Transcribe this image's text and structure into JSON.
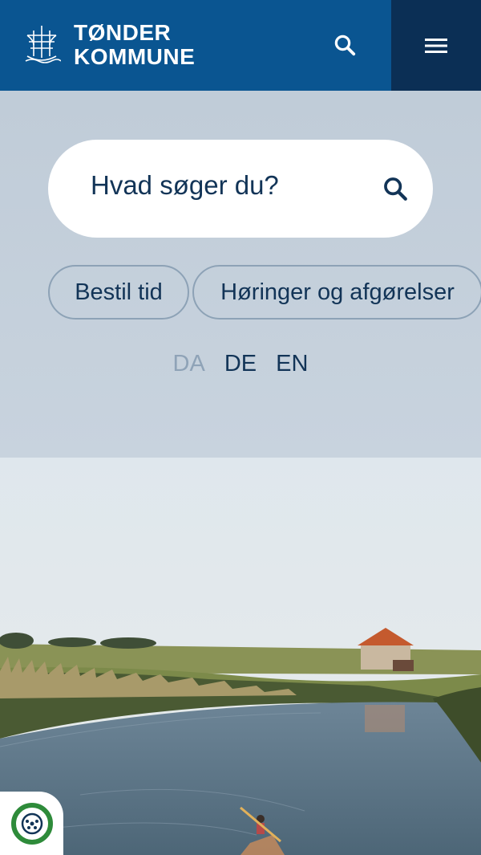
{
  "header": {
    "logo_line1": "TØNDER",
    "logo_line2": "KOMMUNE",
    "search_icon": "search-icon",
    "menu_icon": "hamburger-menu-icon",
    "background": "#0a5591",
    "menu_background": "#0b2f55"
  },
  "hero": {
    "search_placeholder": "Hvad søger du?",
    "quick_links": [
      "Bestil tid",
      "Høringer og afgørelser"
    ],
    "languages": [
      "DA",
      "DE",
      "EN"
    ],
    "active_language": "DA"
  },
  "accessibility_widget": {
    "icon": "accessibility-icon"
  },
  "colors": {
    "text": "#123457",
    "inactive": "#8fa3b7",
    "accent_green": "#2e8b3a"
  }
}
